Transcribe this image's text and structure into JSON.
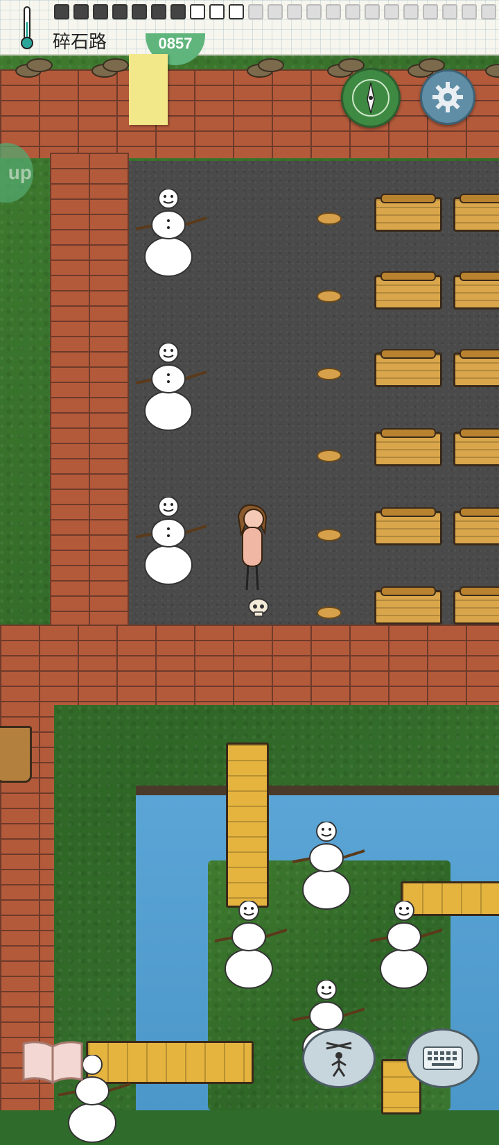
{
  "header": {
    "location_title": "碎石路",
    "bubble_text": "0857"
  },
  "icons": {
    "thermometer": "thermometer-icon",
    "compass": "compass-icon",
    "settings": "gear-icon",
    "book": "book-icon",
    "puppet": "puppet-icon",
    "keyboard": "keyboard-icon"
  },
  "helper": {
    "text": "up"
  },
  "colors": {
    "grass": "#2f6727",
    "brick": "#b35a3b",
    "asphalt": "#4a4a4a",
    "water": "#5aa5d6",
    "compass_green": "#3f8a43",
    "settings_blue": "#5f8ea6"
  }
}
